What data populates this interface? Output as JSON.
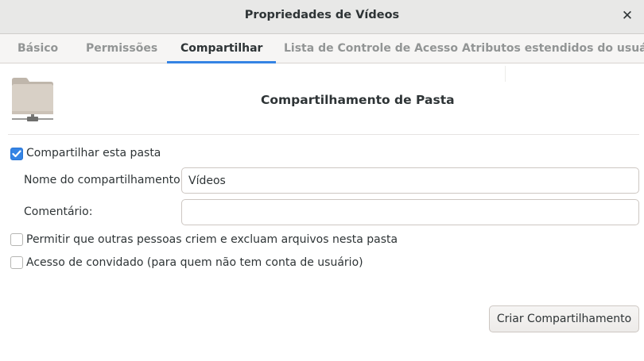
{
  "window": {
    "title": "Propriedades de Vídeos",
    "close_icon": "close-icon"
  },
  "tabs": [
    {
      "label": "Básico",
      "active": false
    },
    {
      "label": "Permissões",
      "active": false
    },
    {
      "label": "Compartilhar",
      "active": true
    },
    {
      "label": "Lista de Controle de Acesso",
      "active": false
    },
    {
      "label": "Atributos estendidos do usuário",
      "active": false
    }
  ],
  "share": {
    "folder_icon": "folder-share-icon",
    "heading": "Compartilhamento de Pasta",
    "share_folder": {
      "label": "Compartilhar esta pasta",
      "checked": true
    },
    "share_name": {
      "label": "Nome do compartilhamento:",
      "value": "Vídeos"
    },
    "comment": {
      "label": "Comentário:",
      "value": ""
    },
    "allow_others": {
      "label": "Permitir que outras pessoas criem e excluam arquivos nesta pasta",
      "checked": false
    },
    "guest_access": {
      "label": "Acesso de convidado (para quem não tem conta de usuário)",
      "checked": false
    },
    "create_button": "Criar Compartilhamento"
  },
  "colors": {
    "accent": "#3584e4",
    "folder": "#d6cfc5",
    "titlebar": "#e8e8e7"
  }
}
